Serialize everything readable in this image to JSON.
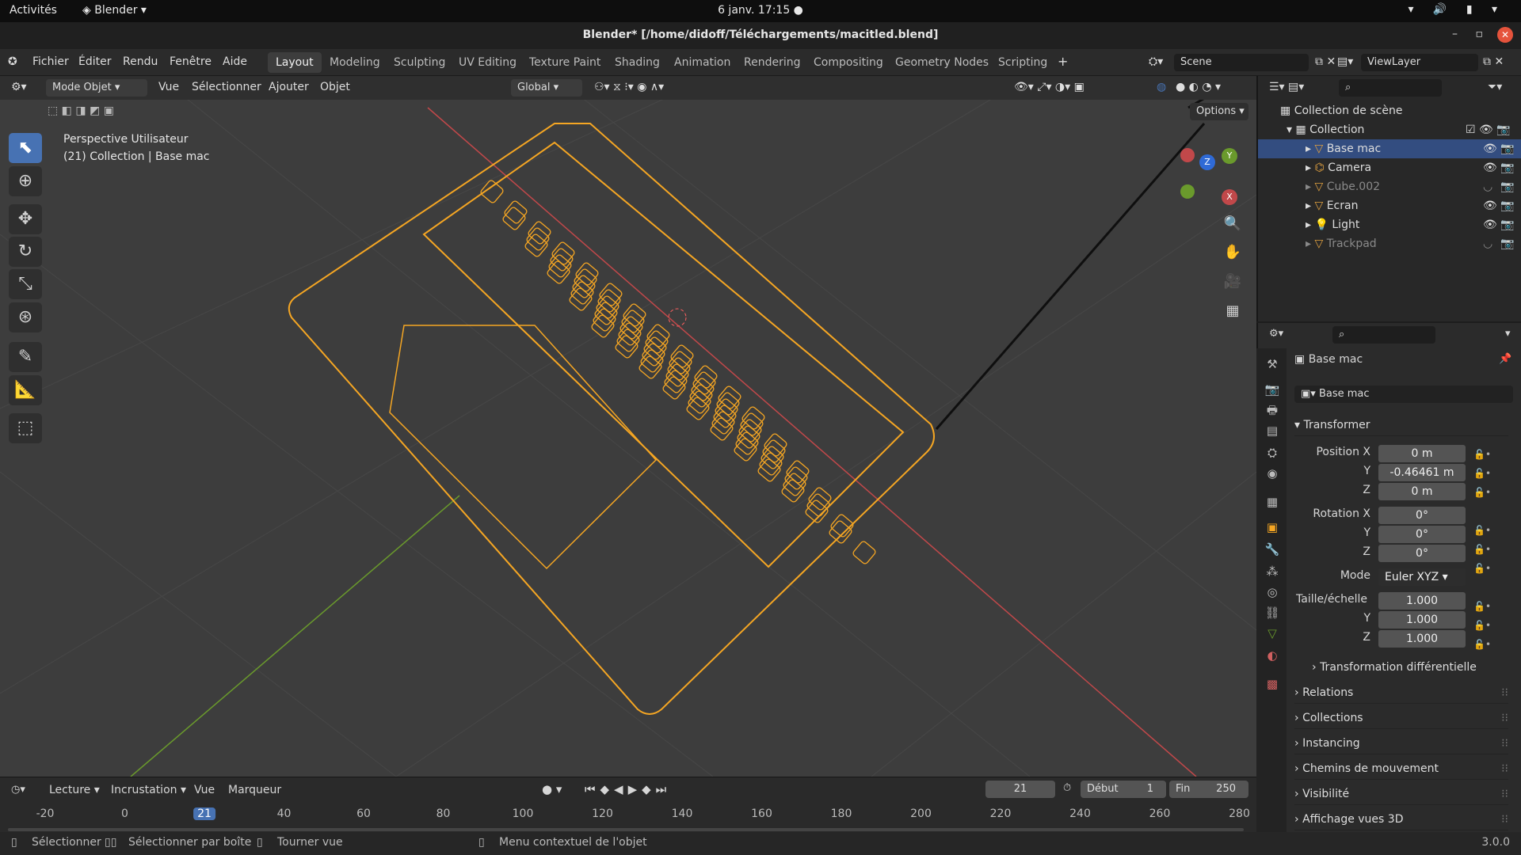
{
  "gnome": {
    "activities": "Activités",
    "app": "Blender",
    "clock": "6 janv.  17:15"
  },
  "window": {
    "title": "Blender* [/home/didoff/Téléchargements/macitled.blend]"
  },
  "menu": {
    "items": [
      "Fichier",
      "Éditer",
      "Rendu",
      "Fenêtre",
      "Aide"
    ]
  },
  "workspaces": [
    "Layout",
    "Modeling",
    "Sculpting",
    "UV Editing",
    "Texture Paint",
    "Shading",
    "Animation",
    "Rendering",
    "Compositing",
    "Geometry Nodes",
    "Scripting"
  ],
  "scene": {
    "name": "Scene",
    "view_layer": "ViewLayer"
  },
  "viewport": {
    "mode": "Mode Objet",
    "menus": [
      "Vue",
      "Sélectionner",
      "Ajouter",
      "Objet"
    ],
    "orientation": "Global",
    "options": "Options",
    "info_line1": "Perspective Utilisateur",
    "info_line2": "(21) Collection | Base mac",
    "gizmo": {
      "x": "X",
      "y": "Y",
      "z": "Z"
    }
  },
  "outliner": {
    "root": "Collection de scène",
    "collection": "Collection",
    "items": [
      {
        "name": "Base mac",
        "selected": true,
        "hidden": false
      },
      {
        "name": "Camera",
        "selected": false,
        "hidden": false
      },
      {
        "name": "Cube.002",
        "selected": false,
        "hidden": true
      },
      {
        "name": "Ecran",
        "selected": false,
        "hidden": false
      },
      {
        "name": "Light",
        "selected": false,
        "hidden": false
      },
      {
        "name": "Trackpad",
        "selected": false,
        "hidden": true
      }
    ]
  },
  "properties": {
    "object_name": "Base mac",
    "datablock": "Base mac",
    "transform_title": "Transformer",
    "position": {
      "label": "Position X",
      "x": "0 m",
      "y": "-0.46461 m",
      "z": "0 m"
    },
    "rotation": {
      "label": "Rotation X",
      "x": "0°",
      "y": "0°",
      "z": "0°"
    },
    "mode_label": "Mode",
    "mode_value": "Euler XYZ",
    "scale": {
      "label": "Taille/échelle",
      "x": "1.000",
      "y": "1.000",
      "z": "1.000"
    },
    "axis_y": "Y",
    "axis_z": "Z",
    "delta": "Transformation différentielle",
    "sections": [
      "Relations",
      "Collections",
      "Instancing",
      "Chemins de mouvement",
      "Visibilité",
      "Affichage vues 3D"
    ]
  },
  "timeline": {
    "menus": [
      "Lecture",
      "Incrustation",
      "Vue",
      "Marqueur"
    ],
    "current_frame": "21",
    "start_label": "Début",
    "start": "1",
    "end_label": "Fin",
    "end": "250",
    "ticks": [
      "-20",
      "0",
      "21",
      "40",
      "60",
      "80",
      "100",
      "120",
      "140",
      "160",
      "180",
      "200",
      "220",
      "240",
      "260",
      "280"
    ]
  },
  "status": {
    "select": "Sélectionner",
    "box_select": "Sélectionner par boîte",
    "rotate": "Tourner vue",
    "context": "Menu contextuel de l'objet",
    "version": "3.0.0"
  },
  "colors": {
    "accent": "#4772b3",
    "selection": "#f5a623",
    "x_axis": "#c1484a",
    "y_axis": "#6a9a2c"
  }
}
